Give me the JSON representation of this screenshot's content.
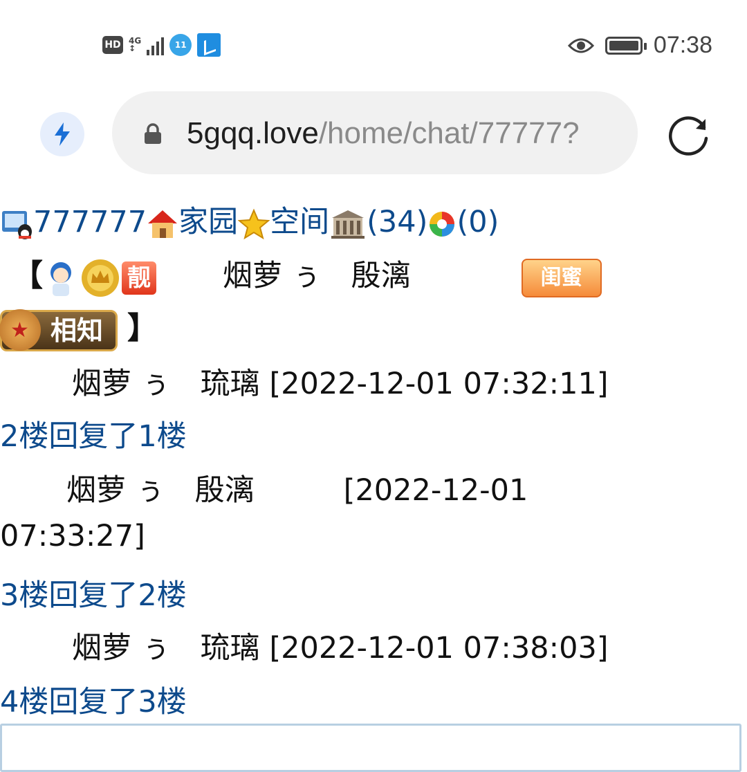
{
  "status_bar": {
    "hd": "HD",
    "network": "4G",
    "notification_badge": "11",
    "time": "07:38"
  },
  "address_bar": {
    "domain": "5gqq.love",
    "path": "/home/chat/77777?"
  },
  "nav": {
    "user_id": "777777",
    "home_link": "家园",
    "space_link": "空间",
    "count_a": "(34)",
    "count_b": "(0)"
  },
  "header_user": {
    "bracket_open": "【",
    "badge_shuai": "靓",
    "name": "烟萝 ぅ　殷漓",
    "badge_guimi": "闺蜜",
    "badge_xiangzhi": "相知",
    "bracket_close": "】"
  },
  "messages": [
    {
      "text": "烟萝 ぅ　琉璃 [2022-12-01 07:32:11]",
      "reply_link": "2楼回复了1楼"
    },
    {
      "text_line1": "烟萝 ぅ　殷漓　　　[2022-12-01",
      "text_line2": "07:33:27]",
      "reply_link": "3楼回复了2楼"
    },
    {
      "text": "烟萝 ぅ　琉璃 [2022-12-01 07:38:03]",
      "reply_link": "4楼回复了3楼"
    }
  ]
}
